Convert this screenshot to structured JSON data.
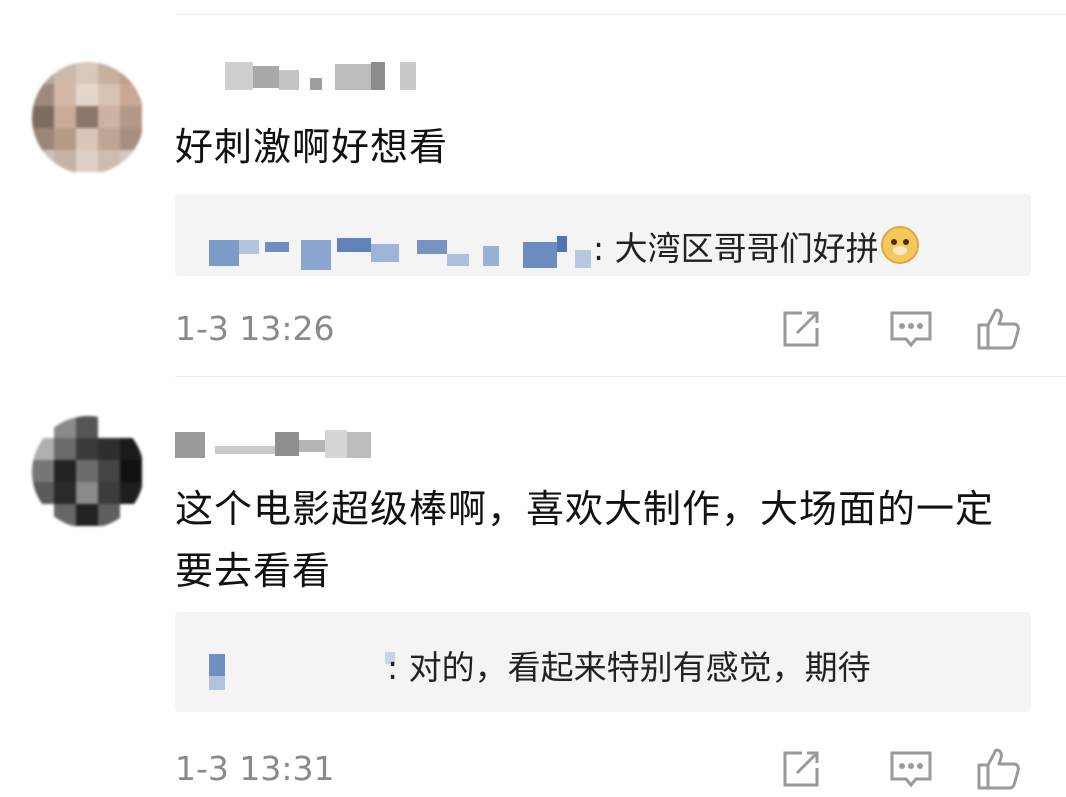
{
  "comments": [
    {
      "text": "好刺激啊好想看",
      "reply": {
        "text": ": 大湾区哥哥们好拼",
        "emoji": "doge-emoji"
      },
      "time": "1-3 13:26"
    },
    {
      "text": "这个电影超级棒啊，喜欢大制作，大场面的一定要去看看",
      "reply": {
        "text": ": 对的，看起来特别有感觉，期待"
      },
      "time": "1-3 13:31"
    }
  ],
  "icons": {
    "repost": "share-square-icon",
    "comment": "comment-bubble-icon",
    "like": "thumbs-up-icon"
  },
  "colors": {
    "text": "#111111",
    "meta": "#8a8a8a",
    "reply_bg": "#f4f4f5",
    "icon": "#9a9a9a"
  }
}
